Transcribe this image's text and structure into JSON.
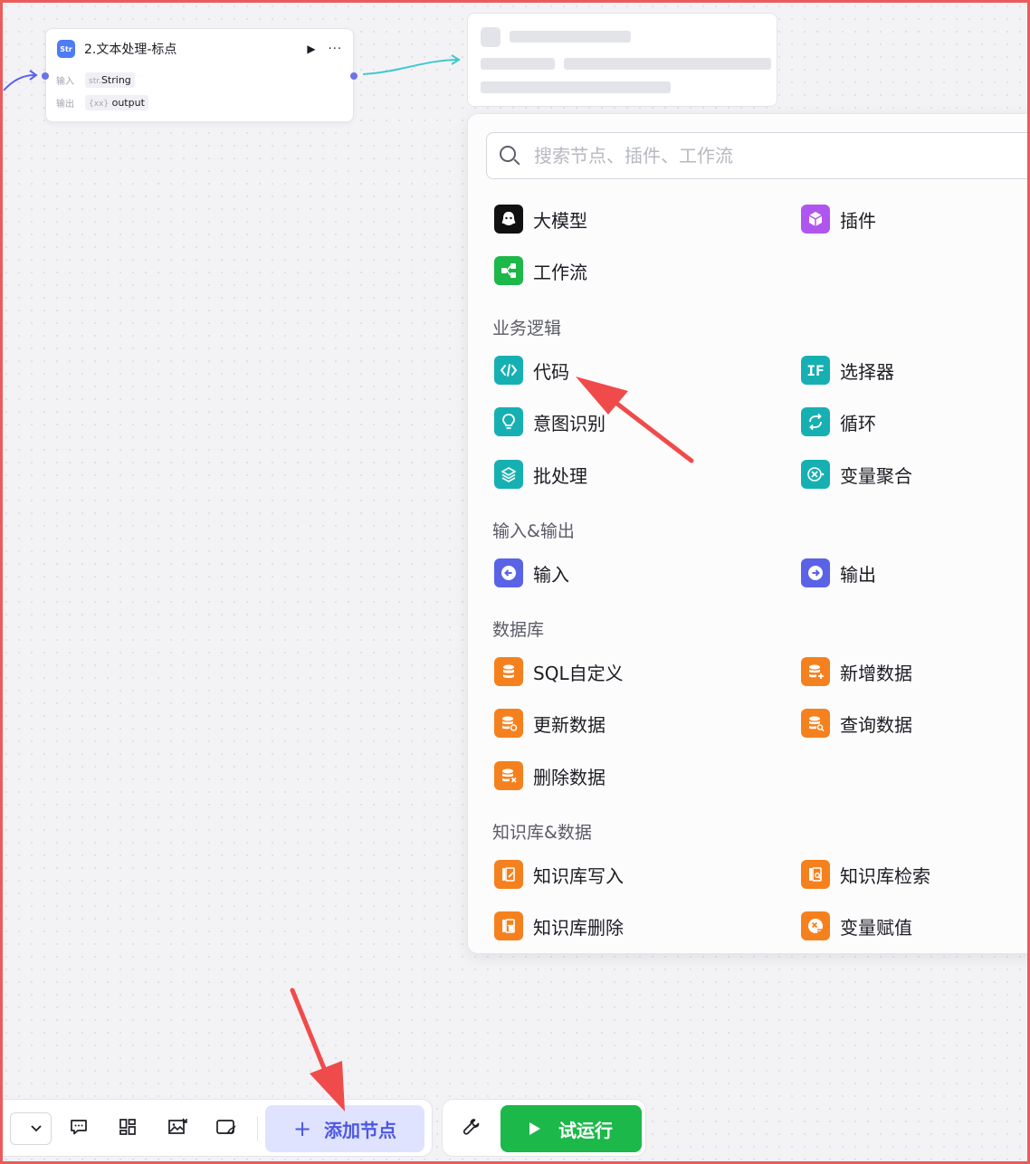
{
  "node": {
    "title": "2.文本处理-标点",
    "input_label": "输入",
    "input_type_prefix": "str.",
    "input_type": "String",
    "output_label": "输出",
    "output_type_prefix": "{xx}",
    "output_name": "output"
  },
  "search": {
    "placeholder": "搜索节点、插件、工作流"
  },
  "panel": {
    "top_items": [
      {
        "label": "大模型",
        "icon": "llm-icon",
        "color": "#111111"
      },
      {
        "label": "插件",
        "icon": "plugin-cube-icon",
        "color": "#b056f0"
      },
      {
        "label": "工作流",
        "icon": "workflow-icon",
        "color": "#1cb84a"
      }
    ],
    "sections": [
      {
        "title": "业务逻辑",
        "items": [
          {
            "label": "代码",
            "icon": "code-icon",
            "color": "#17b0b2"
          },
          {
            "label": "选择器",
            "icon": "if-icon",
            "color": "#17b0b2"
          },
          {
            "label": "意图识别",
            "icon": "bulb-icon",
            "color": "#17b0b2"
          },
          {
            "label": "循环",
            "icon": "loop-icon",
            "color": "#17b0b2"
          },
          {
            "label": "批处理",
            "icon": "layers-icon",
            "color": "#17b0b2"
          },
          {
            "label": "变量聚合",
            "icon": "aggregate-icon",
            "color": "#17b0b2"
          }
        ]
      },
      {
        "title": "输入&输出",
        "items": [
          {
            "label": "输入",
            "icon": "input-arrow-icon",
            "color": "#5a63e6"
          },
          {
            "label": "输出",
            "icon": "output-arrow-icon",
            "color": "#5a63e6"
          }
        ]
      },
      {
        "title": "数据库",
        "items": [
          {
            "label": "SQL自定义",
            "icon": "database-icon",
            "color": "#f5811e"
          },
          {
            "label": "新增数据",
            "icon": "database-add-icon",
            "color": "#f5811e"
          },
          {
            "label": "更新数据",
            "icon": "database-update-icon",
            "color": "#f5811e"
          },
          {
            "label": "查询数据",
            "icon": "database-search-icon",
            "color": "#f5811e"
          },
          {
            "label": "删除数据",
            "icon": "database-delete-icon",
            "color": "#f5811e"
          }
        ]
      },
      {
        "title": "知识库&数据",
        "items": [
          {
            "label": "知识库写入",
            "icon": "kb-write-icon",
            "color": "#f5811e"
          },
          {
            "label": "知识库检索",
            "icon": "kb-search-icon",
            "color": "#f5811e"
          },
          {
            "label": "知识库删除",
            "icon": "kb-delete-icon",
            "color": "#f5811e"
          },
          {
            "label": "变量赋值",
            "icon": "variable-assign-icon",
            "color": "#f5811e"
          }
        ]
      }
    ]
  },
  "toolbar": {
    "add_node_label": "添加节点",
    "run_label": "试运行"
  }
}
